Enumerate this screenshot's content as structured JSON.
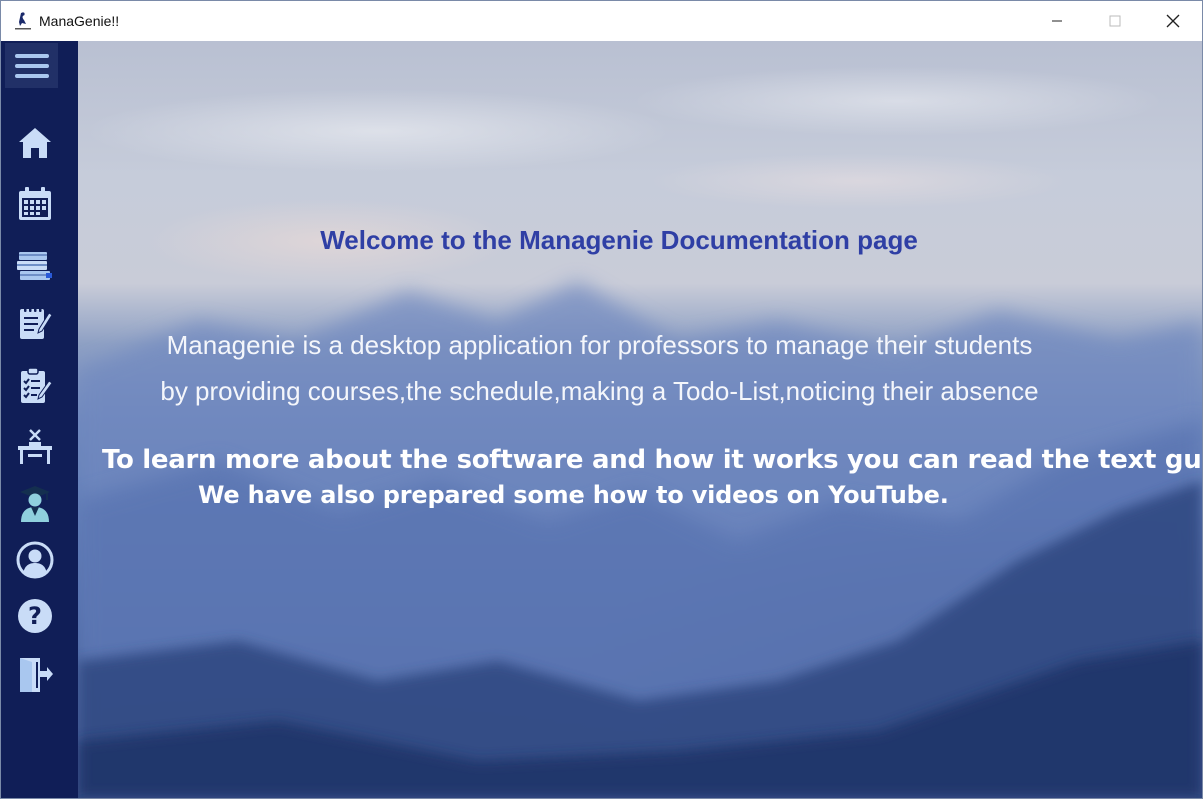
{
  "window": {
    "title": "ManaGenie!!",
    "controls": {
      "minimize_icon": "minimize-icon",
      "maximize_icon": "maximize-icon",
      "close_icon": "close-icon"
    }
  },
  "sidebar": {
    "menu_icon": "hamburger-menu-icon",
    "items": [
      {
        "id": "home",
        "icon": "home-icon"
      },
      {
        "id": "schedule",
        "icon": "calendar-icon"
      },
      {
        "id": "courses",
        "icon": "books-icon"
      },
      {
        "id": "todo",
        "icon": "notepad-edit-icon"
      },
      {
        "id": "absence",
        "icon": "checklist-icon"
      },
      {
        "id": "classroom",
        "icon": "teacher-desk-icon"
      },
      {
        "id": "students",
        "icon": "graduate-icon"
      },
      {
        "id": "profile",
        "icon": "user-profile-icon"
      },
      {
        "id": "help",
        "icon": "help-icon"
      },
      {
        "id": "logout",
        "icon": "logout-icon"
      }
    ]
  },
  "main": {
    "heading": "Welcome to the Managenie Documentation page",
    "description_line1": "Managenie is a desktop application for professors to manage their students",
    "description_line2": "by providing courses,the schedule,making a Todo-List,noticing their absence",
    "guide_line1": "To learn more about the software and how it works you can read the text guides.",
    "guide_line2": "We have also prepared some how to videos on YouTube."
  },
  "colors": {
    "sidebar_bg": "#101e57",
    "icon_color": "#c9dcf7",
    "heading_color": "#2f3fa5",
    "text_color": "#ffffff"
  }
}
